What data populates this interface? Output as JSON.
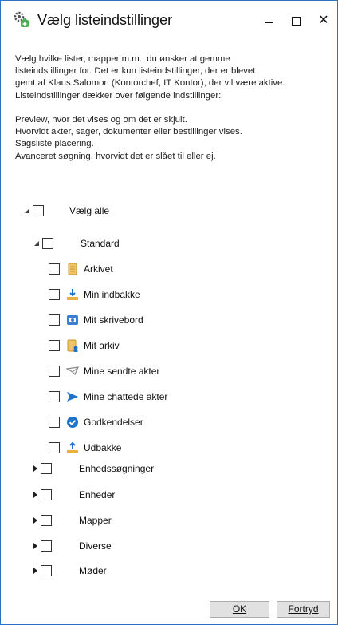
{
  "window": {
    "title": "Vælg listeindstillinger",
    "minimize_label": "minimize",
    "maximize_label": "maximize",
    "close_glyph": "✕"
  },
  "description": {
    "lines": [
      "Vælg hvilke lister, mapper m.m., du ønsker at gemme",
      "listeindstillinger for. Det er kun listeindstillinger, der er blevet",
      "gemt af Klaus Salomon (Kontorchef, IT Kontor), der vil være aktive.",
      "Listeindstillinger dækker over følgende indstillinger:"
    ],
    "items": [
      "Preview, hvor det vises og om det er skjult.",
      "Hvorvidt akter, sager, dokumenter eller bestillinger vises.",
      "Sagsliste placering.",
      "Avanceret søgning, hvorvidt det er slået til eller ej."
    ]
  },
  "tree": {
    "select_all": "Vælg alle",
    "standard": {
      "label": "Standard",
      "children": [
        {
          "label": "Arkivet",
          "icon": "archive-icon"
        },
        {
          "label": "Min indbakke",
          "icon": "inbox-icon"
        },
        {
          "label": "Mit skrivebord",
          "icon": "desk-icon"
        },
        {
          "label": "Mit arkiv",
          "icon": "my-archive-icon"
        },
        {
          "label": "Mine sendte akter",
          "icon": "sent-icon"
        },
        {
          "label": "Mine chattede akter",
          "icon": "chat-send-icon"
        },
        {
          "label": "Godkendelser",
          "icon": "approval-icon"
        },
        {
          "label": "Udbakke",
          "icon": "outbox-icon"
        }
      ]
    },
    "groups": [
      {
        "label": "Enhedssøgninger"
      },
      {
        "label": "Enheder"
      },
      {
        "label": "Mapper"
      },
      {
        "label": "Diverse"
      },
      {
        "label": "Møder"
      }
    ]
  },
  "buttons": {
    "ok_label": "OK",
    "cancel_label": "Fortryd"
  },
  "colors": {
    "window_border": "#2f6fc0",
    "accent_blue": "#1e73c8",
    "icon_yellow": "#e8b23a"
  }
}
